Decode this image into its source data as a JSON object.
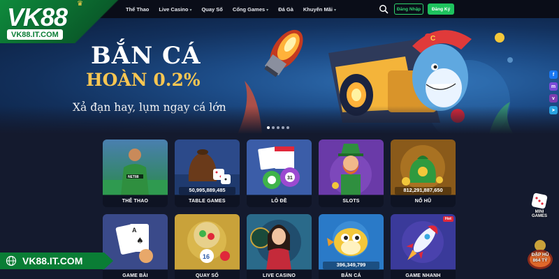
{
  "brand": {
    "logo": "VK88",
    "url_badge": "VK88.IT.COM"
  },
  "nav": {
    "items": [
      {
        "label": "Thể Thao",
        "dropdown": false
      },
      {
        "label": "Live Casino",
        "dropdown": true
      },
      {
        "label": "Quay Số",
        "dropdown": false
      },
      {
        "label": "Cổng Games",
        "dropdown": true
      },
      {
        "label": "Đá Gà",
        "dropdown": false
      },
      {
        "label": "Khuyến Mãi",
        "dropdown": true
      }
    ],
    "login_label": "Đăng Nhập",
    "register_label": "Đăng Ký"
  },
  "banner": {
    "title": "BẮN CÁ",
    "subtitle": "HOÀN 0.2%",
    "tagline": "Xả đạn hay, lụm ngay cá lớn",
    "slides": 5,
    "active_slide": 1
  },
  "social": [
    "facebook",
    "messenger",
    "viber",
    "telegram"
  ],
  "games": [
    {
      "label": "THỂ THAO",
      "jackpot": "",
      "hot": false
    },
    {
      "label": "TABLE GAMES",
      "jackpot": "50,995,889,485",
      "hot": false
    },
    {
      "label": "LÔ ĐỀ",
      "jackpot": "",
      "hot": false
    },
    {
      "label": "SLOTS",
      "jackpot": "",
      "hot": false
    },
    {
      "label": "NỔ HŨ",
      "jackpot": "812,291,887,650",
      "hot": false
    },
    {
      "label": "GAME BÀI",
      "jackpot": "",
      "hot": false
    },
    {
      "label": "QUAY SỐ",
      "jackpot": "",
      "hot": false
    },
    {
      "label": "LIVE CASINO",
      "jackpot": "",
      "hot": false
    },
    {
      "label": "BẮN CÁ",
      "jackpot": "396,349,799",
      "hot": false
    },
    {
      "label": "GAME NHANH",
      "jackpot": "",
      "hot": true
    }
  ],
  "hot_badge": "Hot",
  "widgets": {
    "mini_games": "MINI GAMES",
    "jar_line1": "ĐẬP HŨ",
    "jar_line2": "864 TỶ"
  },
  "watermark": "VK88.IT.COM",
  "colors": {
    "brand_green": "#0e8a3c",
    "accent_green": "#1ec25e",
    "gold": "#f7c652",
    "bg": "#141a2e"
  }
}
